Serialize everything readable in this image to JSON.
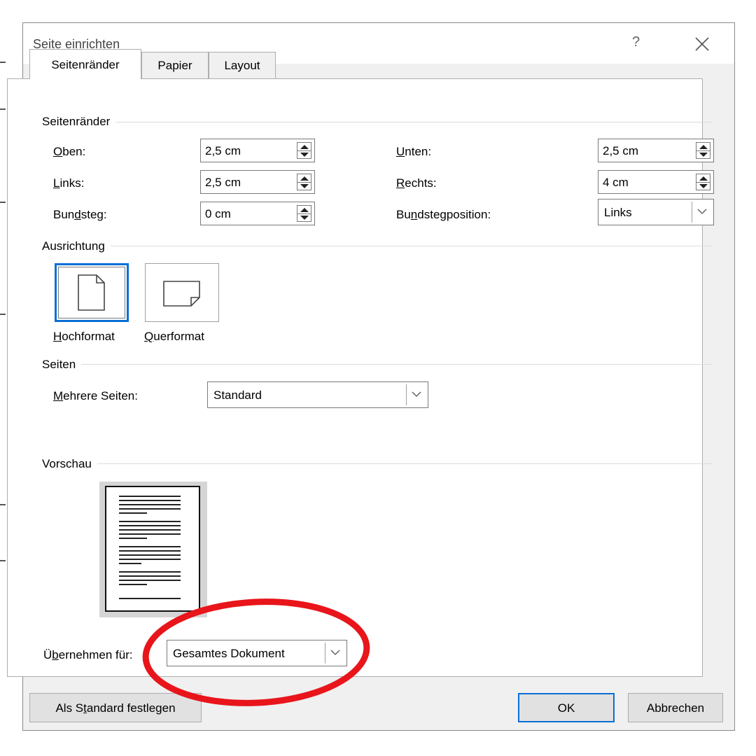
{
  "dialog": {
    "title": "Seite einrichten",
    "help_glyph": "?",
    "tabs": [
      {
        "label": "Seitenränder",
        "active": true
      },
      {
        "label": "Papier",
        "active": false
      },
      {
        "label": "Layout",
        "active": false
      }
    ]
  },
  "margins": {
    "group_title": "Seitenränder",
    "top": {
      "label_u": "O",
      "label_rest": "ben:",
      "value": "2,5 cm"
    },
    "left": {
      "label_u": "L",
      "label_rest": "inks:",
      "value": "2,5 cm"
    },
    "gutter": {
      "label_pre": "Bun",
      "label_u": "d",
      "label_rest": "steg:",
      "value": "0 cm"
    },
    "bottom": {
      "label_u": "U",
      "label_rest": "nten:",
      "value": "2,5 cm"
    },
    "right": {
      "label_u": "R",
      "label_rest": "echts:",
      "value": "4 cm"
    },
    "gutter_pos": {
      "label_pre": "Bu",
      "label_u": "n",
      "label_rest": "dstegposition:",
      "value": "Links"
    }
  },
  "orientation": {
    "group_title": "Ausrichtung",
    "portrait": {
      "label_u": "H",
      "label_rest": "ochformat",
      "selected": true
    },
    "landscape": {
      "label_u": "Q",
      "label_rest": "uerformat",
      "selected": false
    }
  },
  "pages": {
    "group_title": "Seiten",
    "multiple": {
      "label_u": "M",
      "label_rest": "ehrere Seiten:",
      "value": "Standard"
    }
  },
  "preview": {
    "group_title": "Vorschau"
  },
  "apply_to": {
    "label_pre": "Ü",
    "label_u": "b",
    "label_rest": "ernehmen für:",
    "value": "Gesamtes Dokument"
  },
  "buttons": {
    "set_default": {
      "label_pre": "Als S",
      "label_u": "t",
      "label_rest": "andard festlegen"
    },
    "ok": "OK",
    "cancel": "Abbrechen"
  },
  "colors": {
    "accent": "#0a6fd6",
    "annotation": "#e8151b"
  }
}
